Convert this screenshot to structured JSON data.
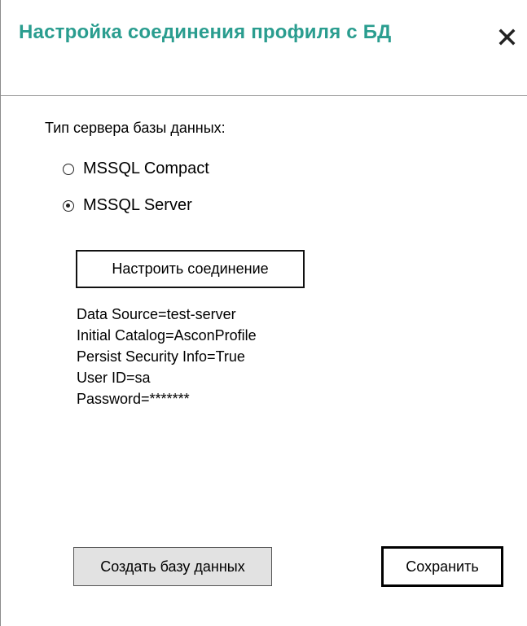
{
  "dialog": {
    "title": "Настройка соединения профиля с БД"
  },
  "server_type": {
    "label": "Тип сервера базы данных:",
    "options": [
      {
        "label": "MSSQL Compact",
        "selected": false
      },
      {
        "label": "MSSQL Server",
        "selected": true
      }
    ]
  },
  "buttons": {
    "configure": "Настроить соединение",
    "create_db": "Создать базу данных",
    "save": "Сохранить"
  },
  "connection_string": [
    "Data Source=test-server",
    "Initial Catalog=AsconProfile",
    "Persist Security Info=True",
    "User ID=sa",
    "Password=*******"
  ],
  "colors": {
    "title": "#2a9d8f"
  },
  "icons": {
    "close": "close-icon"
  }
}
